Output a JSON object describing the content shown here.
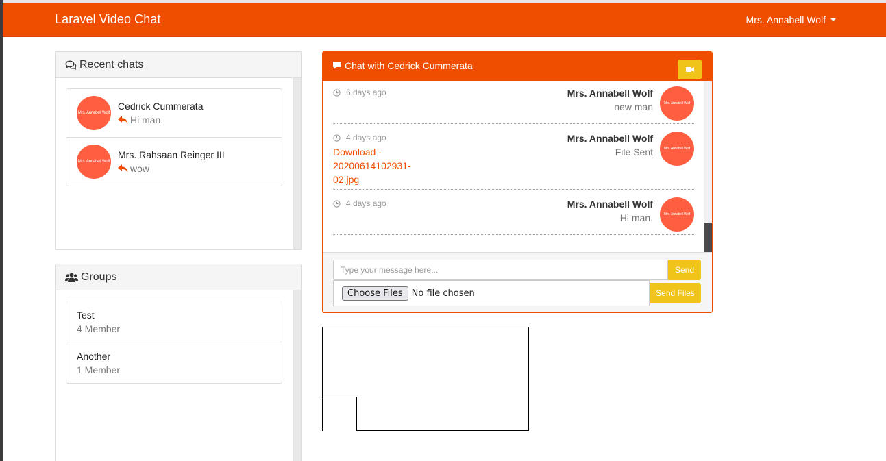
{
  "navbar": {
    "brand": "Laravel Video Chat",
    "user": "Mrs. Annabell Wolf"
  },
  "recent_chats": {
    "title": "Recent chats",
    "items": [
      {
        "name": "Cedrick Cummerata",
        "last_message": "Hi man.",
        "avatar_text": "Mrs. Annabell Wolf"
      },
      {
        "name": "Mrs. Rahsaan Reinger III",
        "last_message": "wow",
        "avatar_text": "Mrs. Annabell Wolf"
      }
    ]
  },
  "groups": {
    "title": "Groups",
    "items": [
      {
        "name": "Test",
        "members": "4 Member"
      },
      {
        "name": "Another",
        "members": "1 Member"
      }
    ]
  },
  "chat": {
    "title": "Chat with Cedrick Cummerata",
    "messages": [
      {
        "time": "6 days ago",
        "author": "Mrs. Annabell Wolf",
        "body": "new man",
        "avatar_text": "Mrs. Annabell Wolf"
      },
      {
        "time": "4 days ago",
        "author": "Mrs. Annabell Wolf",
        "body": "File Sent",
        "avatar_text": "Mrs. Annabell Wolf",
        "link": "Download - 20200614102931-02.jpg"
      },
      {
        "time": "4 days ago",
        "author": "Mrs. Annabell Wolf",
        "body": "Hi man.",
        "avatar_text": "Mrs. Annabell Wolf"
      }
    ],
    "input_placeholder": "Type your message here...",
    "send_label": "Send",
    "choose_files_label": "Choose Files",
    "file_status": "No file chosen",
    "send_files_label": "Send Files"
  },
  "colors": {
    "brand": "#ef4d00",
    "accent": "#f0c419",
    "avatar": "#ff5f40"
  }
}
